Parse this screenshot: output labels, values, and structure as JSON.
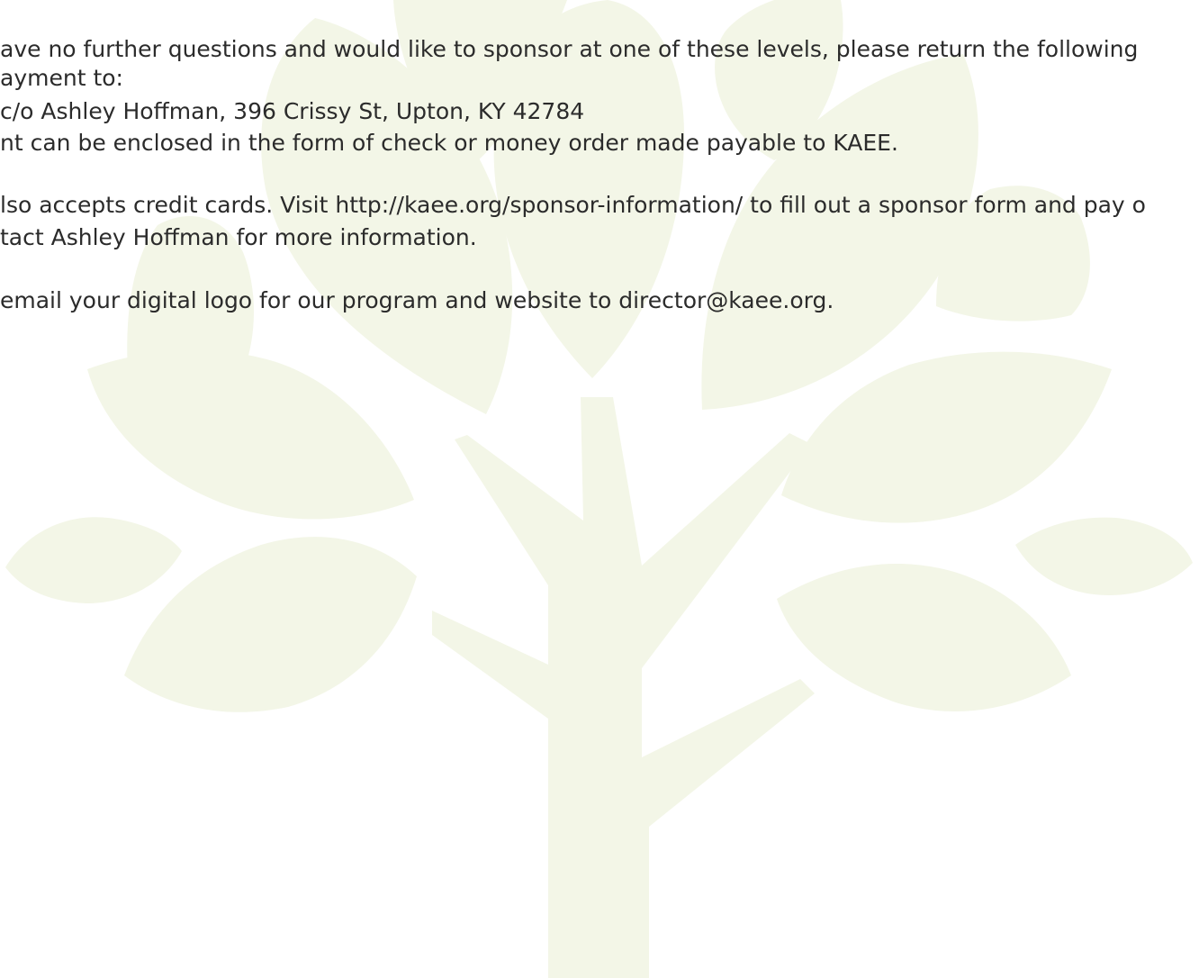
{
  "document": {
    "paragraphs": [
      {
        "lines": [
          "ave no further questions and would like to sponsor at one of these levels, please return the following",
          "ayment to:",
          "c/o Ashley Hoffman, 396 Crissy St, Upton, KY 42784",
          "nt can be enclosed in the form of check or money order made payable to KAEE."
        ]
      },
      {
        "lines": [
          "lso accepts credit cards.  Visit http://kaee.org/sponsor-information/ to fill out a sponsor form and pay o",
          "tact Ashley Hoffman for more information."
        ]
      },
      {
        "lines": [
          "email your digital logo for our program and website to director@kaee.org."
        ]
      }
    ]
  },
  "colors": {
    "text": "#2b2b2b",
    "tree": "#f3f6e7",
    "background": "#ffffff"
  },
  "decoration": {
    "watermark_icon": "tree-icon"
  }
}
